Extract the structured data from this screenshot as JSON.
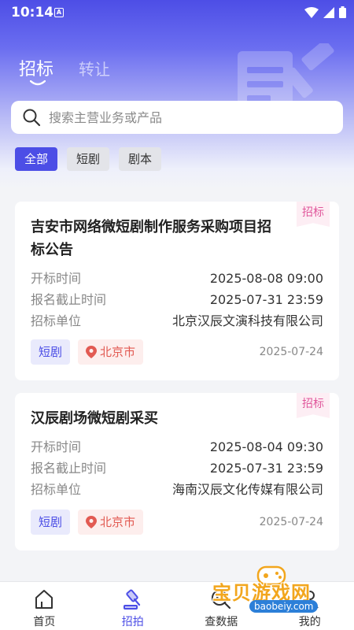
{
  "status_bar": {
    "time": "10:14",
    "notif_icon": "A"
  },
  "tabs": [
    {
      "label": "招标",
      "active": true
    },
    {
      "label": "转让",
      "active": false
    }
  ],
  "search": {
    "placeholder": "搜索主营业务或产品"
  },
  "filters": [
    {
      "label": "全部",
      "active": true
    },
    {
      "label": "短剧",
      "active": false
    },
    {
      "label": "剧本",
      "active": false
    }
  ],
  "cards": [
    {
      "badge": "招标",
      "title": "吉安市网络微短剧制作服务采购项目招标公告",
      "rows": [
        {
          "key": "开标时间",
          "value": "2025-08-08 09:00"
        },
        {
          "key": "报名截止时间",
          "value": "2025-07-31 23:59"
        },
        {
          "key": "招标单位",
          "value": "北京汉辰文演科技有限公司"
        }
      ],
      "genre": "短剧",
      "location": "北京市",
      "date": "2025-07-24"
    },
    {
      "badge": "招标",
      "title": "汉辰剧场微短剧采买",
      "rows": [
        {
          "key": "开标时间",
          "value": "2025-08-04 09:30"
        },
        {
          "key": "报名截止时间",
          "value": "2025-07-31 23:59"
        },
        {
          "key": "招标单位",
          "value": "海南汉辰文化传媒有限公司"
        }
      ],
      "genre": "短剧",
      "location": "北京市",
      "date": "2025-07-24"
    }
  ],
  "bottom_nav": [
    {
      "label": "首页",
      "icon": "home-icon",
      "active": false
    },
    {
      "label": "招拍",
      "icon": "gavel-icon",
      "active": true
    },
    {
      "label": "查数据",
      "icon": "data-icon",
      "active": false
    },
    {
      "label": "我的",
      "icon": "user-icon",
      "active": false
    }
  ],
  "watermark": {
    "text": "宝贝游戏网",
    "url": "baobeiy.com"
  },
  "colors": {
    "primary": "#4c4ee6",
    "badge": "#e0579b",
    "location": "#e25a52"
  }
}
